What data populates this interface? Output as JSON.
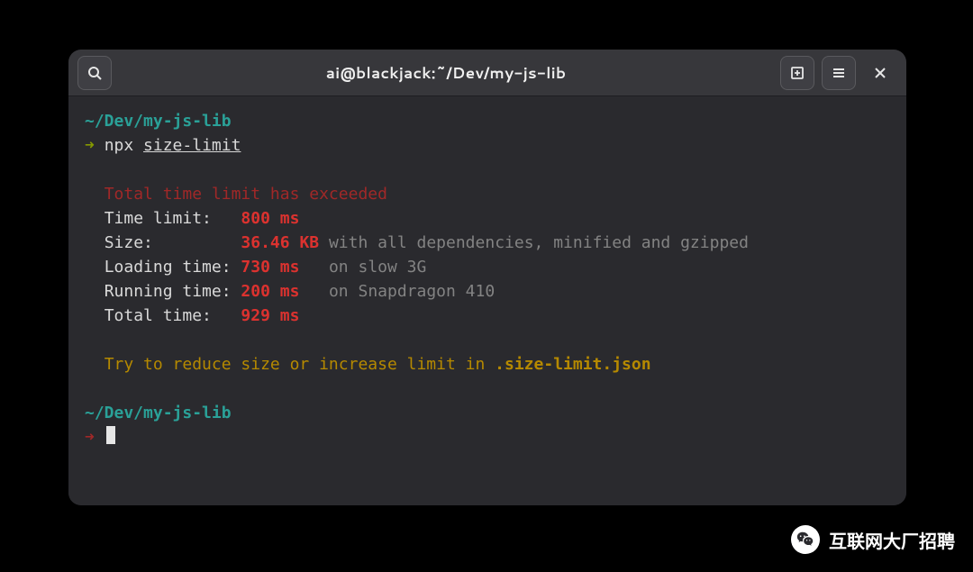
{
  "titlebar": {
    "title": "ai@blackjack:~/Dev/my-js-lib"
  },
  "prompt": {
    "cwd": "~/Dev/my-js-lib",
    "arrow": "➜",
    "command": "npx",
    "arg": "size-limit"
  },
  "output": {
    "error_heading": "Total time limit has exceeded",
    "rows": {
      "time_limit_label": "Time limit:",
      "time_limit_value": "800 ms",
      "size_label": "Size:",
      "size_value": "36.46 KB",
      "size_note": "with all dependencies, minified and gzipped",
      "loading_label": "Loading time:",
      "loading_value": "730 ms",
      "loading_note": "on slow 3G",
      "running_label": "Running time:",
      "running_value": "200 ms",
      "running_note": "on Snapdragon 410",
      "total_label": "Total time:",
      "total_value": "929 ms"
    },
    "hint": {
      "prefix": "Try to reduce size or increase limit in ",
      "filename": ".size-limit.json"
    }
  },
  "watermark": {
    "text": "互联网大厂招聘"
  }
}
